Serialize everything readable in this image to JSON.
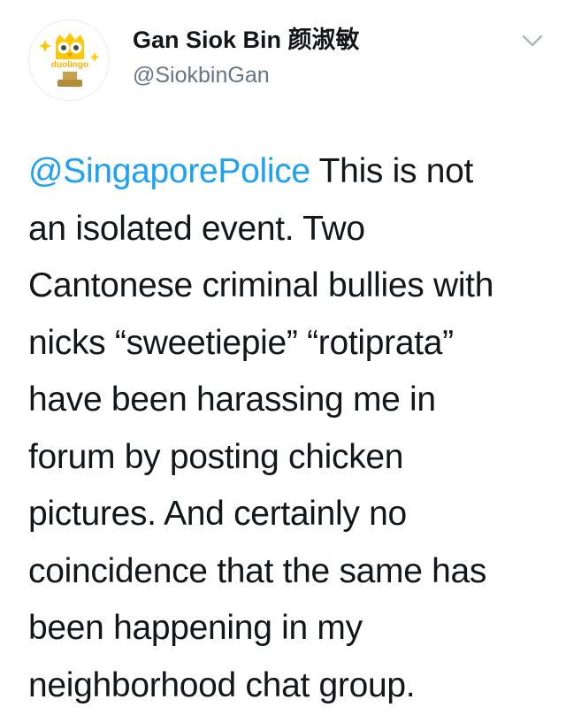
{
  "user": {
    "display_name": "Gan Siok Bin 颜淑敏",
    "handle": "@SiokbinGan",
    "avatar_text": "duolingo"
  },
  "tweet": {
    "mention": "@SingaporePolice",
    "lines": [
      " This is not",
      "an isolated event. Two",
      "Cantonese criminal bullies with",
      "nicks “sweetiepie” “rotiprata”",
      "have been harassing me in",
      "forum by posting chicken",
      "pictures. And certainly no",
      "coincidence that the same has",
      "been happening in my",
      "neighborhood chat group."
    ]
  },
  "icons": {
    "menu": "chevron-down-icon",
    "avatar": "duolingo-owl-icon"
  },
  "colors": {
    "mention": "#1da1f2",
    "handle": "#657786",
    "text": "#14171a",
    "owl": "#ffc800",
    "owl_base": "#c8a14b"
  }
}
